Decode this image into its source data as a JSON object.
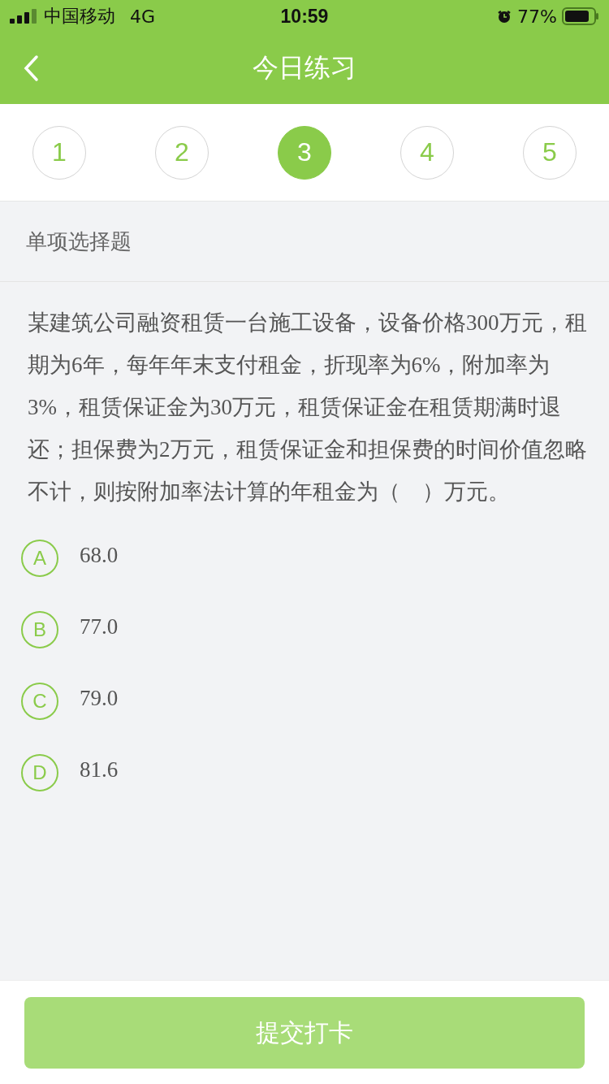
{
  "status_bar": {
    "carrier": "中国移动",
    "network": "4G",
    "time": "10:59",
    "battery": "77%"
  },
  "nav": {
    "title": "今日练习"
  },
  "steps": [
    {
      "label": "1",
      "selected": false
    },
    {
      "label": "2",
      "selected": false
    },
    {
      "label": "3",
      "selected": true
    },
    {
      "label": "4",
      "selected": false
    },
    {
      "label": "5",
      "selected": false
    }
  ],
  "question_type": "单项选择题",
  "question": "某建筑公司融资租赁一台施工设备，设备价格300万元，租期为6年，每年年末支付租金，折现率为6%，附加率为3%，租赁保证金为30万元，租赁保证金在租赁期满时退还；担保费为2万元，租赁保证金和担保费的时间价值忽略不计，则按附加率法计算的年租金为（　）万元。",
  "options": [
    {
      "letter": "A",
      "text": "68.0",
      "selected": false
    },
    {
      "letter": "B",
      "text": "77.0",
      "selected": false
    },
    {
      "letter": "C",
      "text": "79.0",
      "selected": false
    },
    {
      "letter": "D",
      "text": "81.6",
      "selected": false
    }
  ],
  "submit": "提交打卡"
}
